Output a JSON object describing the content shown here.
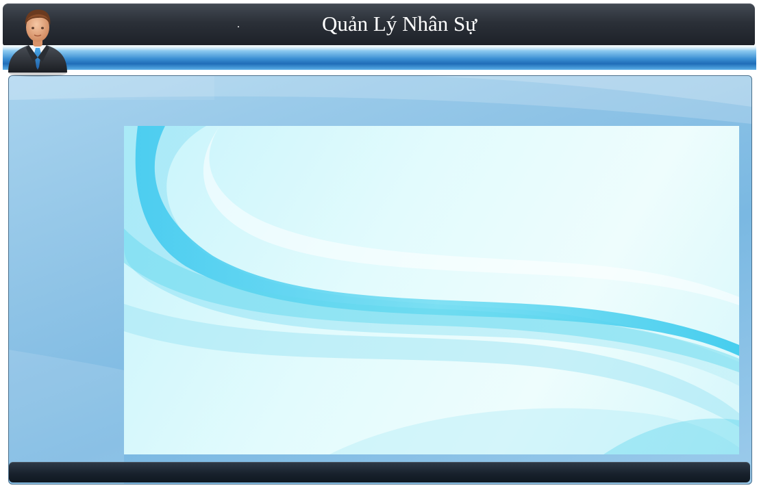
{
  "window": {
    "title": "Quản Lý Nhân Sự",
    "title_dot": "."
  },
  "icons": {
    "avatar": "businessman-avatar-icon"
  },
  "colors": {
    "title_bar": "#2b3038",
    "accent_band": "#1f6db8",
    "panel_background": "#8ec3e6",
    "status_bar": "#17202b"
  }
}
